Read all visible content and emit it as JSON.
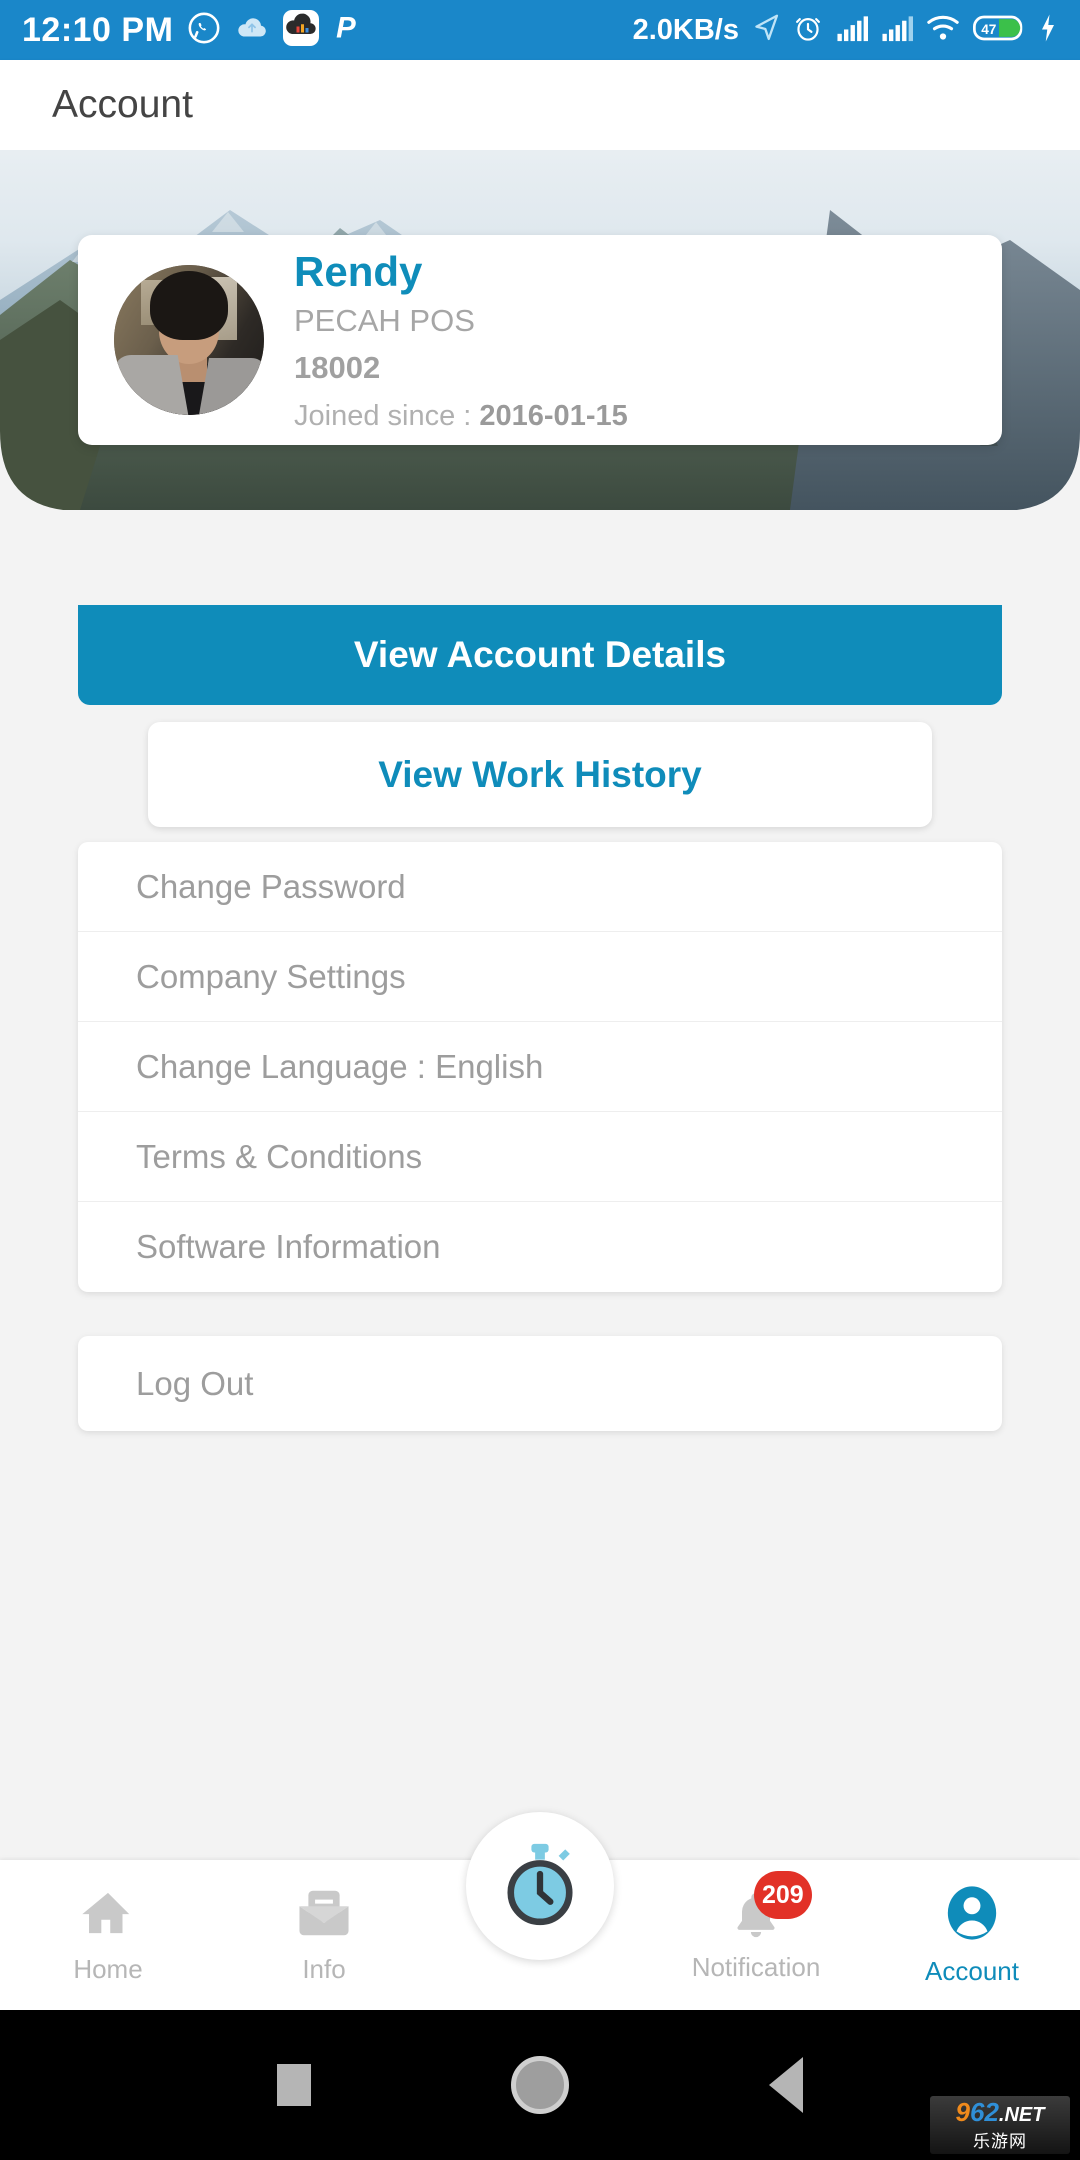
{
  "status_bar": {
    "time": "12:10 PM",
    "network_speed": "2.0KB/s",
    "battery_level": "47",
    "left_icons": [
      "whatsapp-icon",
      "cloud-icon",
      "cloud-app-icon",
      "p-app-icon"
    ],
    "right_icons": [
      "location-arrow-icon",
      "alarm-icon",
      "signal-bars-icon",
      "signal-bars-2-icon",
      "wifi-icon",
      "battery-icon",
      "charging-bolt-icon"
    ],
    "background_color": "#1a87c9"
  },
  "app_bar": {
    "title": "Account"
  },
  "profile": {
    "name": "Rendy",
    "company": "PECAH POS",
    "employee_id": "18002",
    "joined_label": "Joined since : ",
    "joined_date": "2016-01-15",
    "name_color": "#0f8dba"
  },
  "actions": {
    "view_account_details": "View Account Details",
    "view_work_history": "View Work History",
    "primary_color": "#0f8cba"
  },
  "menu": {
    "items": [
      {
        "label": "Change Password"
      },
      {
        "label": "Company Settings"
      },
      {
        "label": "Change Language : English"
      },
      {
        "label": "Terms & Conditions"
      },
      {
        "label": "Software Information"
      }
    ],
    "logout": "Log Out"
  },
  "bottom_nav": {
    "items": [
      {
        "label": "Home",
        "icon": "home-icon",
        "active": false
      },
      {
        "label": "Info",
        "icon": "envelope-icon",
        "active": false
      },
      {
        "label": "Notification",
        "icon": "bell-icon",
        "active": false,
        "badge": "209"
      },
      {
        "label": "Account",
        "icon": "person-icon",
        "active": true
      }
    ],
    "fab_icon": "stopwatch-icon",
    "active_color": "#0f8cba",
    "inactive_color": "#b6b6b6",
    "badge_color": "#e23127"
  },
  "android_nav": {
    "recents": "recents-square-icon",
    "home": "home-circle-icon",
    "back": "back-triangle-icon"
  },
  "watermark": {
    "nine": "9",
    "sixtytwo": "62",
    "net": ".NET",
    "chinese": "乐游网"
  }
}
